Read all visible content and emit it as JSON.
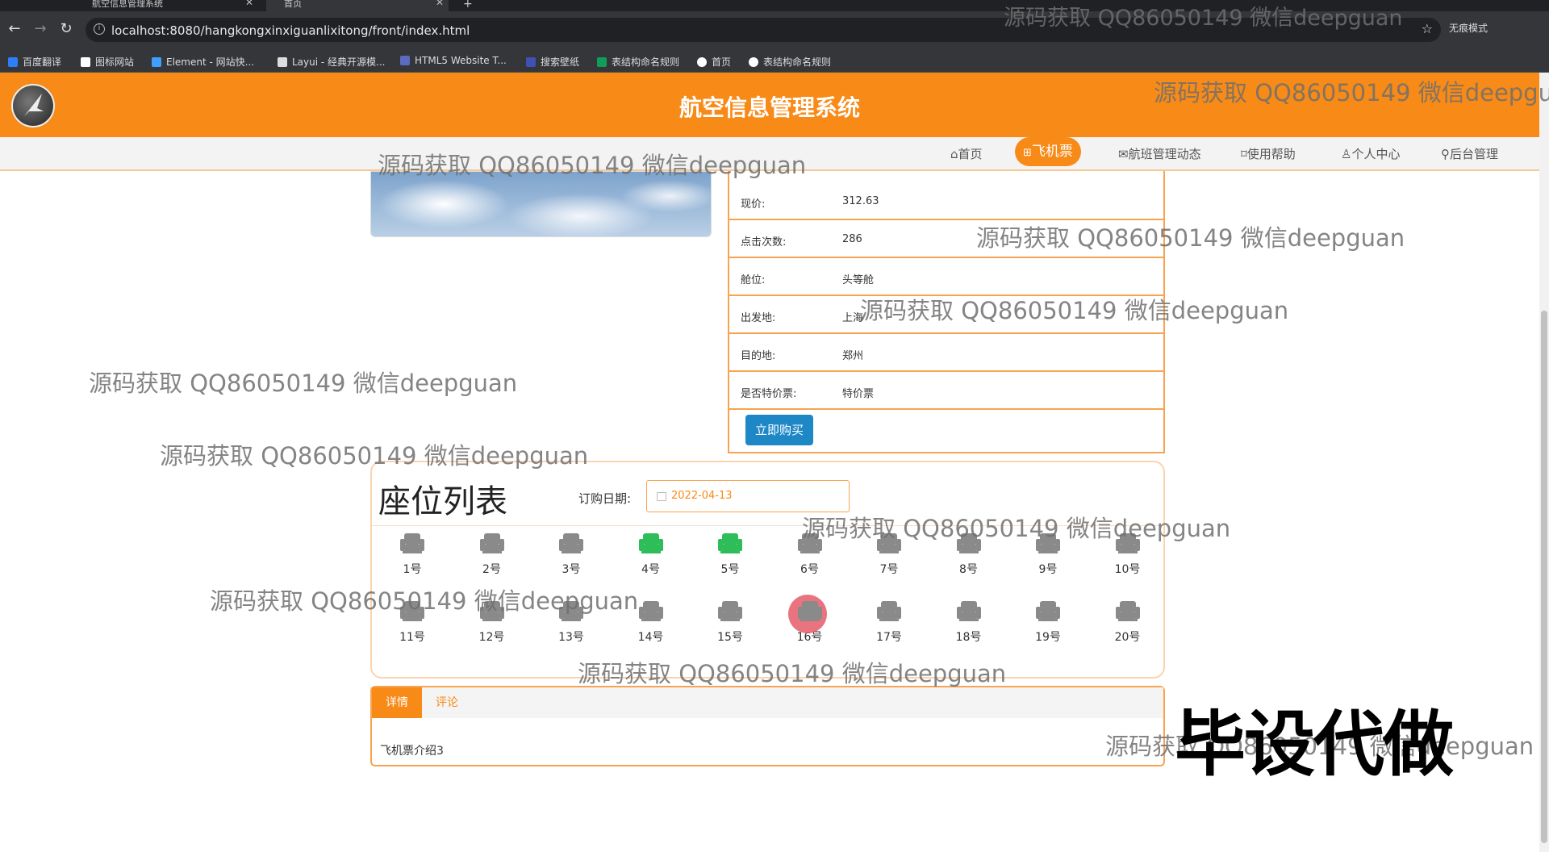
{
  "browser": {
    "tabs": [
      {
        "title": "航空信息管理系统"
      },
      {
        "title": "首页"
      }
    ],
    "new_tab": "+",
    "url": "localhost:8080/hangkongxinxiguanlixitong/front/index.html",
    "incognito_label": "无痕模式",
    "bookmarks": [
      {
        "label": "百度翻译",
        "color": "#2d7ff9"
      },
      {
        "label": "图标网站",
        "color": "#ffffff"
      },
      {
        "label": "Element - 网站快...",
        "color": "#409eff"
      },
      {
        "label": "Layui - 经典开源模...",
        "color": "#dddddd"
      },
      {
        "label": "HTML5 Website T...",
        "color": "#5c6bc0"
      },
      {
        "label": "搜索壁纸",
        "color": "#3f51b5"
      },
      {
        "label": "表结构命名规则",
        "color": "#0f9d58"
      },
      {
        "label": "首页",
        "color": "#ffffff"
      },
      {
        "label": "表结构命名规则",
        "color": "#ffffff"
      }
    ]
  },
  "header": {
    "title": "航空信息管理系统"
  },
  "nav": {
    "items": [
      {
        "label": "首页",
        "icon": "home-icon"
      },
      {
        "label": "飞机票",
        "icon": "grid-icon",
        "active": true
      },
      {
        "label": "航班管理动态",
        "icon": "mail-icon"
      },
      {
        "label": "使用帮助",
        "icon": "tag-icon"
      },
      {
        "label": "个人中心",
        "icon": "user-icon"
      },
      {
        "label": "后台管理",
        "icon": "link-icon"
      }
    ]
  },
  "detail": {
    "rows": [
      {
        "key": "现价:",
        "value": "312.63"
      },
      {
        "key": "点击次数:",
        "value": "286"
      },
      {
        "key": "舱位:",
        "value": "头等舱"
      },
      {
        "key": "出发地:",
        "value": "上海"
      },
      {
        "key": "目的地:",
        "value": "郑州"
      },
      {
        "key": "是否特价票:",
        "value": "特价票"
      }
    ],
    "buy_label": "立即购买"
  },
  "seats": {
    "title": "座位列表",
    "date_label": "订购日期:",
    "date_value": "2022-04-13",
    "list": [
      {
        "label": "1号",
        "status": "available"
      },
      {
        "label": "2号",
        "status": "available"
      },
      {
        "label": "3号",
        "status": "available"
      },
      {
        "label": "4号",
        "status": "booked"
      },
      {
        "label": "5号",
        "status": "booked"
      },
      {
        "label": "6号",
        "status": "available"
      },
      {
        "label": "7号",
        "status": "available"
      },
      {
        "label": "8号",
        "status": "available"
      },
      {
        "label": "9号",
        "status": "available"
      },
      {
        "label": "10号",
        "status": "available"
      },
      {
        "label": "11号",
        "status": "available"
      },
      {
        "label": "12号",
        "status": "available"
      },
      {
        "label": "13号",
        "status": "available"
      },
      {
        "label": "14号",
        "status": "available"
      },
      {
        "label": "15号",
        "status": "available"
      },
      {
        "label": "16号",
        "status": "selected"
      },
      {
        "label": "17号",
        "status": "available"
      },
      {
        "label": "18号",
        "status": "available"
      },
      {
        "label": "19号",
        "status": "available"
      },
      {
        "label": "20号",
        "status": "available"
      }
    ],
    "colors": {
      "available": "#8a8a8a",
      "booked": "#2ebd59",
      "selected": "#8a8a8a"
    }
  },
  "tabs": {
    "items": [
      {
        "label": "详情",
        "active": true
      },
      {
        "label": "评论",
        "active": false
      }
    ],
    "content": "飞机票介绍3"
  },
  "overlay": {
    "watermark_text": "源码获取 QQ86050149 微信deepguan",
    "watermark_top_right": "源码获取 QQ86050149 微信deepguan",
    "watermark_header": "源码获取 QQ86050149 微信deepgu",
    "watermark_bottom_right": "源码获取 QQ86050149 微信deepguan",
    "stamp_text": "毕设代做"
  }
}
